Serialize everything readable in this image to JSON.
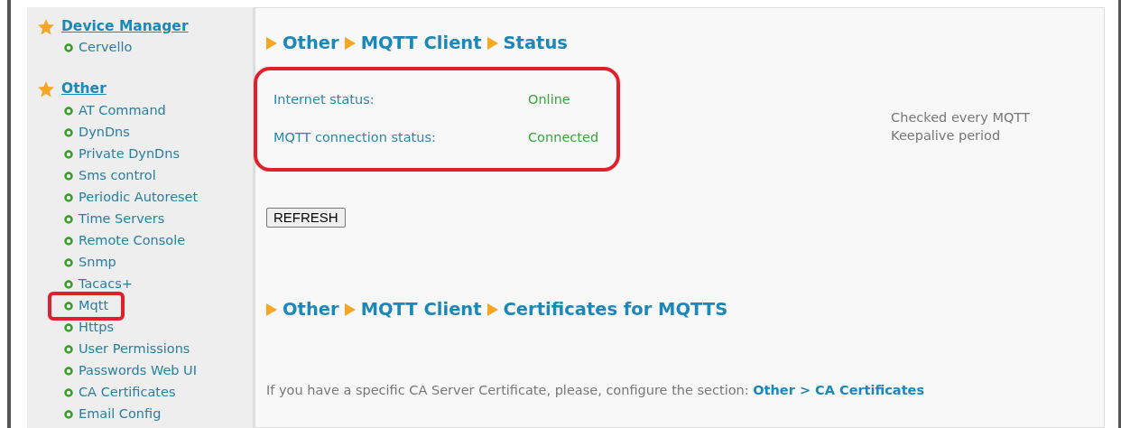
{
  "sidebar": {
    "groups": [
      {
        "title": "Device Manager",
        "items": [
          {
            "label": "Cervello",
            "annotated": false
          }
        ]
      },
      {
        "title": "Other",
        "items": [
          {
            "label": "AT Command",
            "annotated": false
          },
          {
            "label": "DynDns",
            "annotated": false
          },
          {
            "label": "Private DynDns",
            "annotated": false
          },
          {
            "label": "Sms control",
            "annotated": false
          },
          {
            "label": "Periodic Autoreset",
            "annotated": false
          },
          {
            "label": "Time Servers",
            "annotated": false
          },
          {
            "label": "Remote Console",
            "annotated": false
          },
          {
            "label": "Snmp",
            "annotated": false
          },
          {
            "label": "Tacacs+",
            "annotated": false
          },
          {
            "label": "Mqtt",
            "annotated": true
          },
          {
            "label": "Https",
            "annotated": false
          },
          {
            "label": "User Permissions",
            "annotated": false
          },
          {
            "label": "Passwords Web UI",
            "annotated": false
          },
          {
            "label": "CA Certificates",
            "annotated": false
          },
          {
            "label": "Email Config",
            "annotated": false
          }
        ]
      }
    ]
  },
  "status_section": {
    "breadcrumb": [
      "Other",
      "MQTT Client",
      "Status"
    ],
    "annotated": true,
    "rows": [
      {
        "label": "Internet status:",
        "value": "Online"
      },
      {
        "label": "MQTT connection status:",
        "value": "Connected"
      }
    ],
    "note": "Checked every MQTT Keepalive period",
    "refresh_button": "REFRESH"
  },
  "certificates_section": {
    "breadcrumb": [
      "Other",
      "MQTT Client",
      "Certificates for MQTTS"
    ],
    "text": "If you have a specific CA Server Certificate, please, configure the section:",
    "link": "Other > CA Certificates"
  }
}
